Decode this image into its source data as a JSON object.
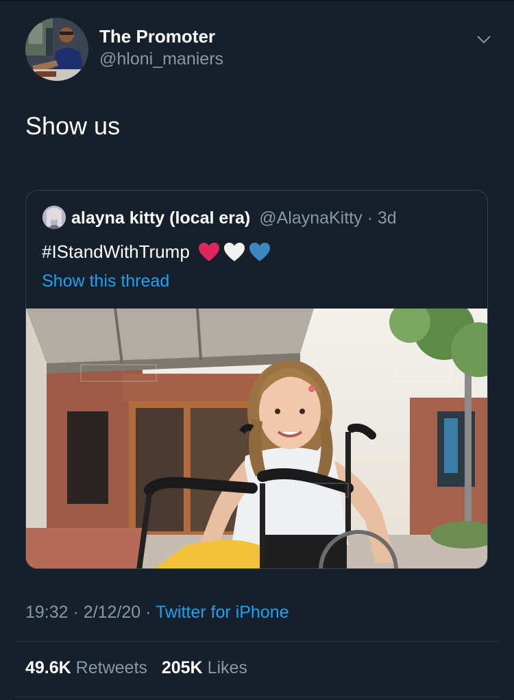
{
  "tweet": {
    "author": {
      "display_name": "The Promoter",
      "handle": "@hloni_maniers",
      "avatar_icon": "avatar-photo"
    },
    "text": "Show us",
    "menu_icon": "chevron-down-icon",
    "quoted": {
      "author": {
        "display_name": "alayna kitty (local era)",
        "handle": "@AlaynaKitty",
        "separator": " · ",
        "age": "3d"
      },
      "text": "#IStandWithTrump",
      "emoji": [
        "red-heart-icon",
        "white-heart-icon",
        "blue-heart-icon"
      ],
      "show_thread": "Show this thread",
      "image_icon": "photo-girl-in-wheelchair"
    },
    "meta": {
      "time": "19:32",
      "sep1": " · ",
      "date": "2/12/20",
      "sep2": " · ",
      "source": "Twitter for iPhone"
    },
    "stats": {
      "retweets_count": "49.6K",
      "retweets_label": "Retweets",
      "likes_count": "205K",
      "likes_label": "Likes"
    }
  },
  "colors": {
    "background": "#15202b",
    "secondary_text": "#8899a6",
    "link": "#1da1f2",
    "border": "#38444d"
  }
}
